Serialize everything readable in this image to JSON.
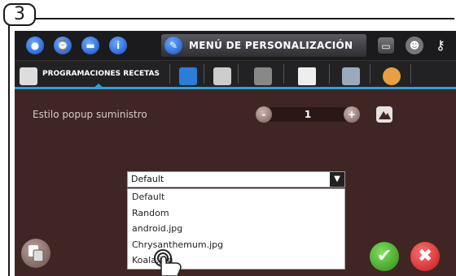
{
  "step_label": "3",
  "header": {
    "menu_title": "MENÚ DE PERSONALIZACIÓN",
    "icons": [
      "water-drop-icon",
      "clock-icon",
      "bookmark-icon",
      "info-icon",
      "brush-icon",
      "monitor-icon",
      "user-icon",
      "wrench-icon"
    ]
  },
  "subtabs": {
    "active_label": "PROGRAMACIONES RECETAS",
    "icons": [
      "book-icon",
      "book-blue-icon",
      "picture-icon",
      "screen-icon",
      "speaker-icon",
      "bottle-icon",
      "palette-icon"
    ]
  },
  "setting": {
    "label": "Estilo popup suministro",
    "minus": "-",
    "value": "1",
    "plus": "+"
  },
  "dropdown": {
    "selected": "Default",
    "options": [
      "Default",
      "Random",
      "android.jpg",
      "Chrysanthemum.jpg",
      "Koala.jpg"
    ]
  },
  "colors": {
    "background": "#3f2624",
    "accent": "#29a3d8",
    "confirm": "#3aa620",
    "cancel": "#d42020"
  }
}
